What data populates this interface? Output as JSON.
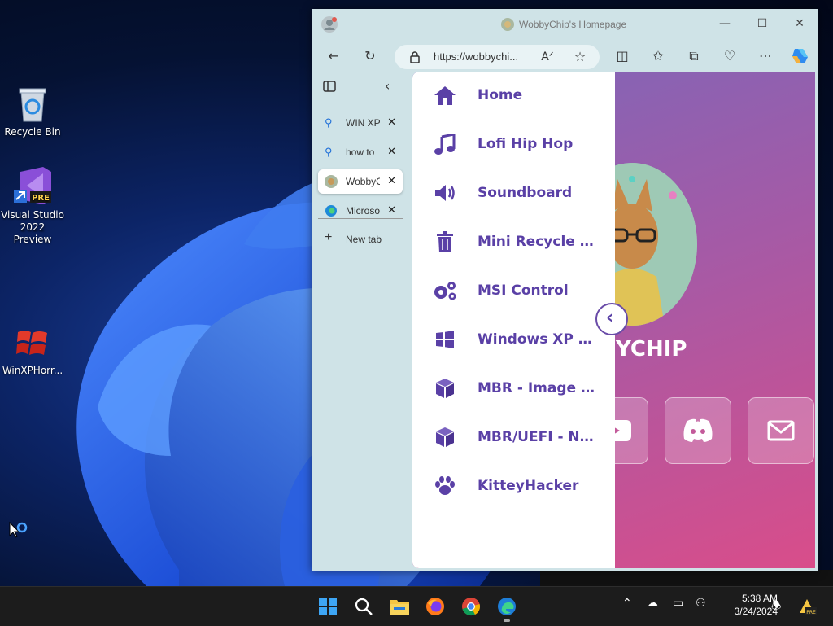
{
  "desktop": {
    "icons": [
      {
        "label": "Recycle Bin"
      },
      {
        "label": "Visual Studio 2022 Preview",
        "badge": "PRE"
      },
      {
        "label": "WinXPHorr..."
      }
    ]
  },
  "browser": {
    "title": "WobbyChip's Homepage",
    "url": "https://wobbychi...",
    "tabs": [
      {
        "label": "WIN XP",
        "icon": "search-icon"
      },
      {
        "label": "how to",
        "icon": "search-icon"
      },
      {
        "label": "WobbyC",
        "icon": "favicon-avatar"
      },
      {
        "label": "Microso",
        "icon": "edge-icon"
      }
    ],
    "new_tab_label": "New tab"
  },
  "page": {
    "menu": [
      {
        "label": "Home",
        "icon": "home-icon"
      },
      {
        "label": "Lofi Hip Hop",
        "icon": "music-icon"
      },
      {
        "label": "Soundboard",
        "icon": "speaker-icon"
      },
      {
        "label": "Mini Recycle Bin",
        "icon": "trash-icon"
      },
      {
        "label": "MSI Control",
        "icon": "gears-icon"
      },
      {
        "label": "Windows XP Horr...",
        "icon": "windows-icon"
      },
      {
        "label": "MBR - Image Buil...",
        "icon": "cube-icon"
      },
      {
        "label": "MBR/UEFI - Note ...",
        "icon": "cube-icon"
      },
      {
        "label": "KitteyHacker",
        "icon": "paw-icon"
      }
    ],
    "brand": "YCHIP"
  },
  "taskbar": {
    "time": "5:38 AM",
    "date": "3/24/2024"
  },
  "colors": {
    "menu_text": "#5a40a6",
    "page_gradient_start": "#7e66b8",
    "page_gradient_end": "#d94d8a",
    "taskbar": "#1c1c1c"
  }
}
